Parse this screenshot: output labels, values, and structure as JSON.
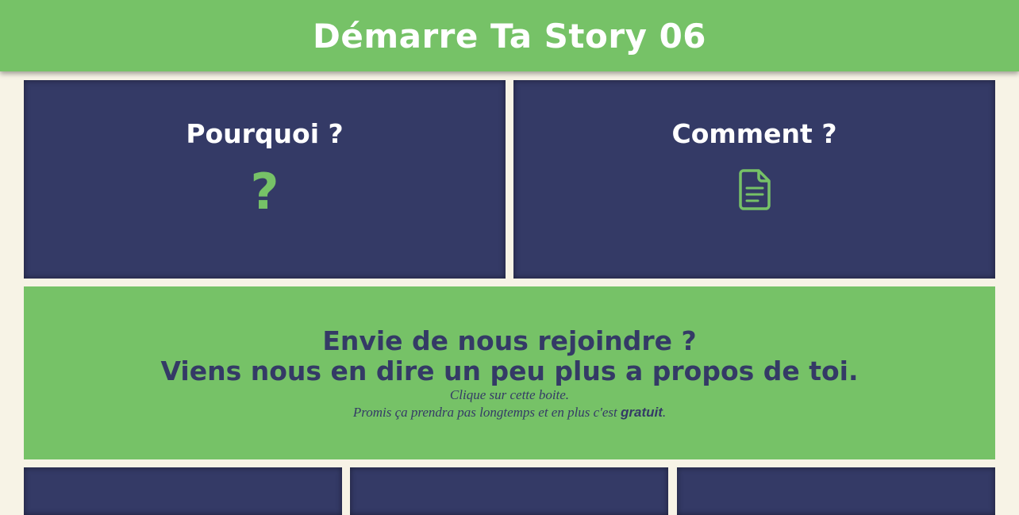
{
  "header": {
    "title": "Démarre Ta Story 06"
  },
  "tiles": [
    {
      "title": "Pourquoi ?",
      "icon": "question-mark-icon",
      "icon_glyph": "?"
    },
    {
      "title": "Comment ?",
      "icon": "document-icon"
    }
  ],
  "join": {
    "line1": "Envie de nous rejoindre ?",
    "line2": "Viens nous en dire un peu plus a propos de toi.",
    "sub1": "Clique sur cette boite.",
    "sub2_before": "Promis ça prendra pas longtemps et en plus c'est ",
    "sub2_bold": "gratuit",
    "sub2_after": "."
  },
  "colors": {
    "accent_green": "#76c267",
    "navy": "#343a66",
    "background": "#f7f3e6"
  }
}
